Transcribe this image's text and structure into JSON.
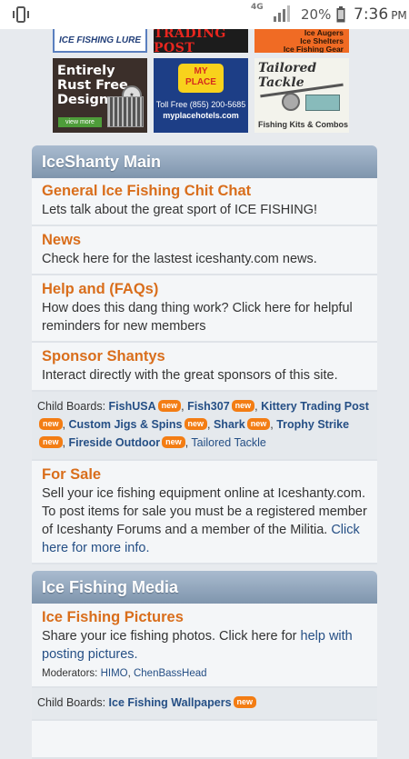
{
  "status_bar": {
    "network": "4G",
    "battery_percent": "20%",
    "time": "7:36",
    "ampm": "PM",
    "icons": [
      "vibrate-icon",
      "signal-icon",
      "battery-icon"
    ]
  },
  "ads": {
    "lure": "ICE FISHING LURE",
    "trading_post": "TRADING POST",
    "augers": [
      "Ice Augers",
      "Ice Shelters",
      "Ice Fishing Gear"
    ],
    "rust": {
      "lines": [
        "Entirely",
        "Rust Free",
        "Design"
      ],
      "button": "view more"
    },
    "place": {
      "logo_top": "MY",
      "logo_bottom": "PLACE",
      "phone": "Toll Free (855) 200-5685",
      "site": "myplacehotels.com"
    },
    "tackle": {
      "title": "Tailored Tackle",
      "subtitle": "Fishing Kits & Combos"
    }
  },
  "sections": {
    "main": {
      "title": "IceShanty Main",
      "boards": {
        "chit_chat": {
          "title": "General Ice Fishing Chit Chat",
          "desc": "Lets talk about the great sport of ICE FISHING!"
        },
        "news": {
          "title": "News",
          "desc": "Check here for the lastest iceshanty.com news."
        },
        "help": {
          "title": "Help and (FAQs)",
          "desc": "How does this dang thing work? Click here for helpful reminders for new members"
        },
        "sponsor": {
          "title": "Sponsor Shantys",
          "desc": "Interact directly with the great sponsors of this site."
        }
      },
      "child_boards": {
        "label": "Child Boards:",
        "items": [
          {
            "name": "FishUSA",
            "new": "new"
          },
          {
            "name": "Fish307",
            "new": "new"
          },
          {
            "name": "Kittery Trading Post",
            "new": "new"
          },
          {
            "name": "Custom Jigs & Spins",
            "new": "new"
          },
          {
            "name": "Shark",
            "new": "new"
          },
          {
            "name": "Trophy Strike",
            "new": "new"
          },
          {
            "name": "Fireside Outdoor",
            "new": "new"
          },
          {
            "name": "Tailored Tackle",
            "new": ""
          }
        ]
      },
      "for_sale": {
        "title": "For Sale",
        "desc": "Sell your ice fishing equipment online at Iceshanty.com. To post items for sale you must be a registered member of Iceshanty Forums and a member of the Militia. ",
        "link": "Click here for more info."
      }
    },
    "media": {
      "title": "Ice Fishing Media",
      "pictures": {
        "title": "Ice Fishing Pictures",
        "desc": "Share your ice fishing photos. Click here for ",
        "link": "help with posting pictures.",
        "moderators_label": "Moderators:",
        "moderators": [
          "HIMO",
          "ChenBassHead"
        ]
      },
      "child_boards": {
        "label": "Child Boards:",
        "items": [
          {
            "name": "Ice Fishing Wallpapers",
            "new": "new"
          }
        ]
      }
    }
  },
  "colors": {
    "header_gradient_top": "#a9bbcf",
    "header_gradient_bottom": "#7f95ad",
    "board_title": "#d96e1c",
    "link": "#254f85",
    "new_badge": "#f37d14"
  }
}
